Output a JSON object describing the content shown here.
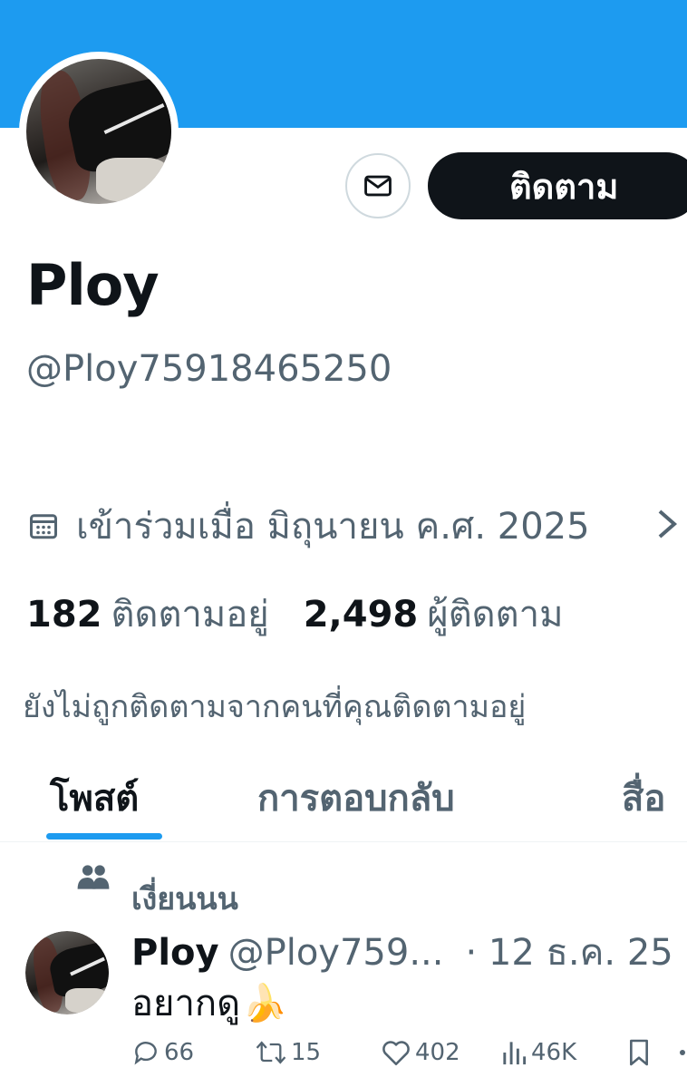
{
  "profile": {
    "display_name": "Ploy",
    "handle": "@Ploy75918465250",
    "follow_label": "ติดตาม",
    "joined": "เข้าร่วมเมื่อ มิถุนายน ค.ศ. 2025",
    "following_count": "182",
    "following_label": "ติดตามอยู่",
    "followers_count": "2,498",
    "followers_label": "ผู้ติดตาม",
    "not_followed_note": "ยังไม่ถูกติดตามจากคนที่คุณติดตามอยู่"
  },
  "tabs": [
    {
      "label": "โพสต์"
    },
    {
      "label": "การตอบกลับ"
    },
    {
      "label": "สื่อ"
    }
  ],
  "tweet": {
    "repost_label": "เงี่ยนนน",
    "name": "Ploy",
    "handle": "@Ploy759...",
    "time": "· 12 ธ.ค. 25",
    "text": "อยากดู",
    "emoji": "🍌",
    "replies": "66",
    "reposts": "15",
    "likes": "402",
    "views": "46K"
  },
  "colors": {
    "banner": "#1d9bf0",
    "follow_button": "#0f1419",
    "secondary_text": "#536471",
    "accent": "#1d9bf0"
  },
  "icons": [
    "mail-icon",
    "calendar-icon",
    "chevron-right-icon",
    "people-icon",
    "reply-icon",
    "repost-icon",
    "like-icon",
    "views-icon",
    "bookmark-icon"
  ]
}
